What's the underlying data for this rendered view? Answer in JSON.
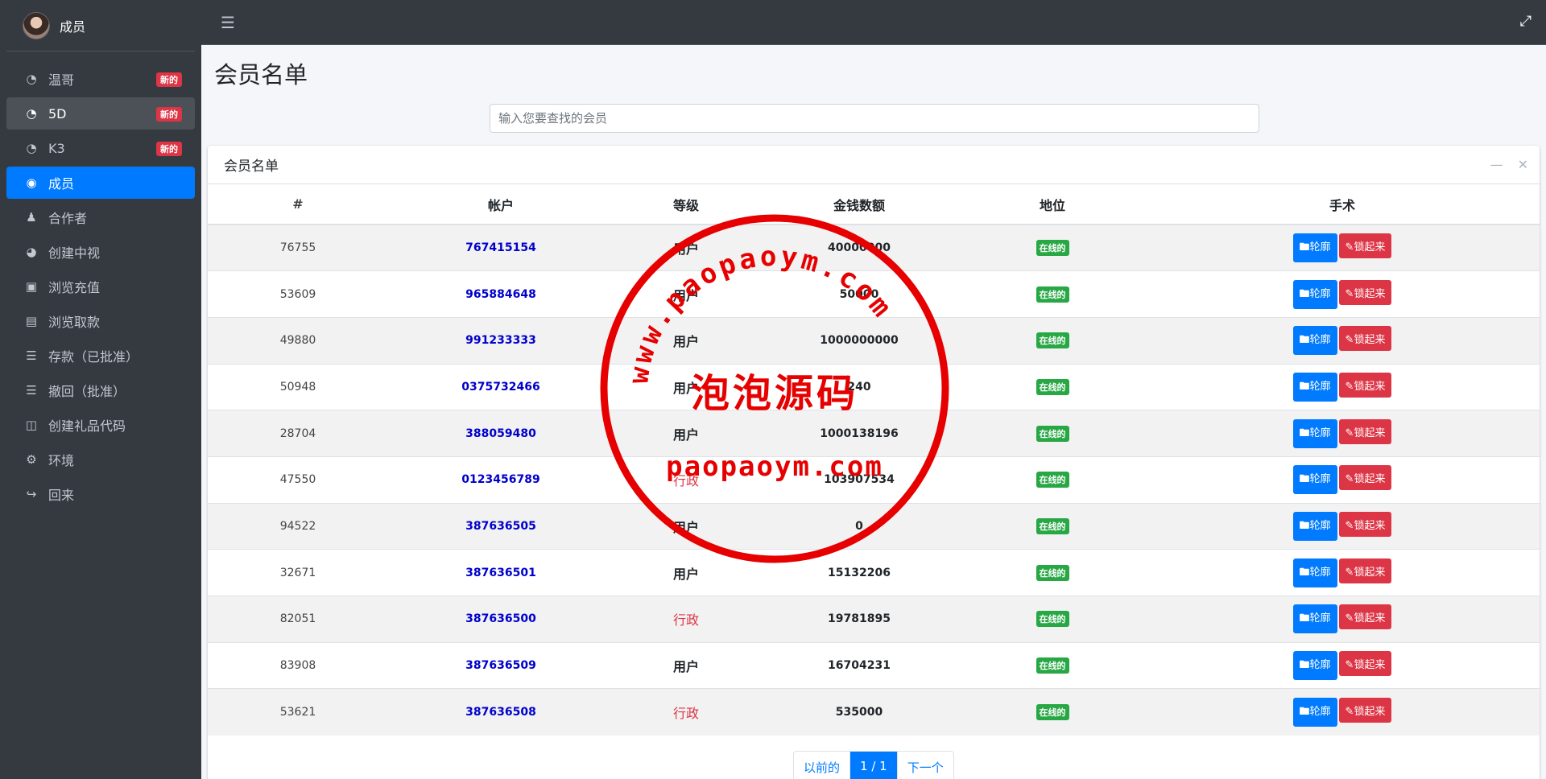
{
  "sidebar": {
    "user_name": "成员",
    "items": [
      {
        "label": "温哥",
        "icon": "dashboard-icon",
        "badge": "新的"
      },
      {
        "label": "5D",
        "icon": "dashboard-icon",
        "badge": "新的"
      },
      {
        "label": "K3",
        "icon": "dashboard-icon",
        "badge": "新的"
      },
      {
        "label": "成员",
        "icon": "user-circle-icon",
        "badge": ""
      },
      {
        "label": "合作者",
        "icon": "users-icon",
        "badge": ""
      },
      {
        "label": "创建中视",
        "icon": "pie-chart-icon",
        "badge": ""
      },
      {
        "label": "浏览充值",
        "icon": "credit-card-icon",
        "badge": ""
      },
      {
        "label": "浏览取款",
        "icon": "bank-icon",
        "badge": ""
      },
      {
        "label": "存款（已批准）",
        "icon": "list-icon",
        "badge": ""
      },
      {
        "label": "撤回（批准）",
        "icon": "list-icon",
        "badge": ""
      },
      {
        "label": "创建礼品代码",
        "icon": "gift-icon",
        "badge": ""
      },
      {
        "label": "环境",
        "icon": "gear-icon",
        "badge": ""
      },
      {
        "label": "回来",
        "icon": "sign-out-icon",
        "badge": ""
      }
    ]
  },
  "page": {
    "title": "会员名单",
    "search_placeholder": "输入您要查找的会员"
  },
  "card": {
    "title": "会员名单",
    "columns": [
      "#",
      "帐户",
      "等级",
      "金钱数额",
      "地位",
      "手术"
    ],
    "view_label": "轮廓",
    "lock_label": "锁起来",
    "rows": [
      {
        "id": "76755",
        "account": "767415154",
        "level": "用户",
        "money": "40000000",
        "status": "在线的"
      },
      {
        "id": "53609",
        "account": "965884648",
        "level": "用户",
        "money": "50000",
        "status": "在线的"
      },
      {
        "id": "49880",
        "account": "991233333",
        "level": "用户",
        "money": "1000000000",
        "status": "在线的"
      },
      {
        "id": "50948",
        "account": "0375732466",
        "level": "用户",
        "money": "240",
        "status": "在线的"
      },
      {
        "id": "28704",
        "account": "388059480",
        "level": "用户",
        "money": "1000138196",
        "status": "在线的"
      },
      {
        "id": "47550",
        "account": "0123456789",
        "level": "行政",
        "money": "103907534",
        "status": "在线的"
      },
      {
        "id": "94522",
        "account": "387636505",
        "level": "用户",
        "money": "0",
        "status": "在线的"
      },
      {
        "id": "32671",
        "account": "387636501",
        "level": "用户",
        "money": "15132206",
        "status": "在线的"
      },
      {
        "id": "82051",
        "account": "387636500",
        "level": "行政",
        "money": "19781895",
        "status": "在线的"
      },
      {
        "id": "83908",
        "account": "387636509",
        "level": "用户",
        "money": "16704231",
        "status": "在线的"
      },
      {
        "id": "53621",
        "account": "387636508",
        "level": "行政",
        "money": "535000",
        "status": "在线的"
      }
    ]
  },
  "pagination": {
    "prev": "以前的",
    "current": "1 / 1",
    "next": "下一个"
  },
  "watermark": {
    "arc_text": "www.paopaoym.com",
    "center_text": "泡泡源码",
    "bottom_text": "paopaoym.com",
    "color": "#e60000"
  },
  "colors": {
    "sidebar_bg": "#343a40",
    "accent": "#007bff",
    "danger": "#dc3545",
    "success": "#28a745"
  }
}
